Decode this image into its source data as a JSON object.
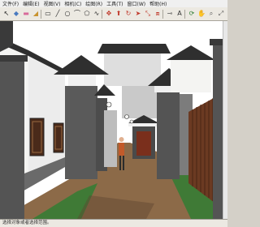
{
  "menubar": {
    "items": [
      "文件(F)",
      "编辑(E)",
      "视图(V)",
      "相机(C)",
      "绘图(R)",
      "工具(T)",
      "窗口(W)",
      "帮助(H)"
    ]
  },
  "toolbar": {
    "tools": [
      {
        "name": "select-tool-icon",
        "glyph": "↖",
        "color": "#1d1d1d"
      },
      {
        "name": "make-component-icon",
        "glyph": "◆",
        "color": "#4a7abf"
      },
      {
        "name": "eraser-icon",
        "glyph": "▬",
        "color": "#d86a9a"
      },
      {
        "name": "paint-bucket-icon",
        "glyph": "◢",
        "color": "#c8932f"
      },
      {
        "name": "rectangle-icon",
        "glyph": "▭",
        "color": "#2e2e2e"
      },
      {
        "name": "line-icon",
        "glyph": "╱",
        "color": "#2e2e2e"
      },
      {
        "name": "circle-icon",
        "glyph": "○",
        "color": "#2e2e2e"
      },
      {
        "name": "arc-icon",
        "glyph": "⌒",
        "color": "#2e2e2e"
      },
      {
        "name": "polygon-icon",
        "glyph": "⬠",
        "color": "#2e2e2e"
      },
      {
        "name": "freehand-icon",
        "glyph": "∿",
        "color": "#2e2e2e"
      },
      {
        "name": "move-icon",
        "glyph": "✥",
        "color": "#c0392b"
      },
      {
        "name": "push-pull-icon",
        "glyph": "⬆",
        "color": "#c0392b"
      },
      {
        "name": "rotate-icon",
        "glyph": "↻",
        "color": "#c0392b"
      },
      {
        "name": "follow-me-icon",
        "glyph": "➤",
        "color": "#c0392b"
      },
      {
        "name": "scale-icon",
        "glyph": "⤡",
        "color": "#c0392b"
      },
      {
        "name": "offset-icon",
        "glyph": "⧈",
        "color": "#c0392b"
      },
      {
        "name": "tape-measure-icon",
        "glyph": "⊸",
        "color": "#555"
      },
      {
        "name": "text-icon",
        "glyph": "A",
        "color": "#333"
      },
      {
        "name": "orbit-icon",
        "glyph": "⟳",
        "color": "#2e7d32"
      },
      {
        "name": "pan-icon",
        "glyph": "✋",
        "color": "#555"
      },
      {
        "name": "zoom-icon",
        "glyph": "⌕",
        "color": "#555"
      },
      {
        "name": "zoom-extents-icon",
        "glyph": "⤢",
        "color": "#555"
      }
    ]
  },
  "statusbar": {
    "text": "选择对象或者选择范围。"
  },
  "scene": {
    "sky": "#ffffff",
    "wall_white": "#f4f4f2",
    "wall_grey": "#545454",
    "wall_dark": "#3a3a3a",
    "roof_dark": "#2f2f2f",
    "path": "#8c6a48",
    "grass": "#3f7a36",
    "wood_panel": "#6b3a22",
    "door": "#7a2f1c"
  }
}
